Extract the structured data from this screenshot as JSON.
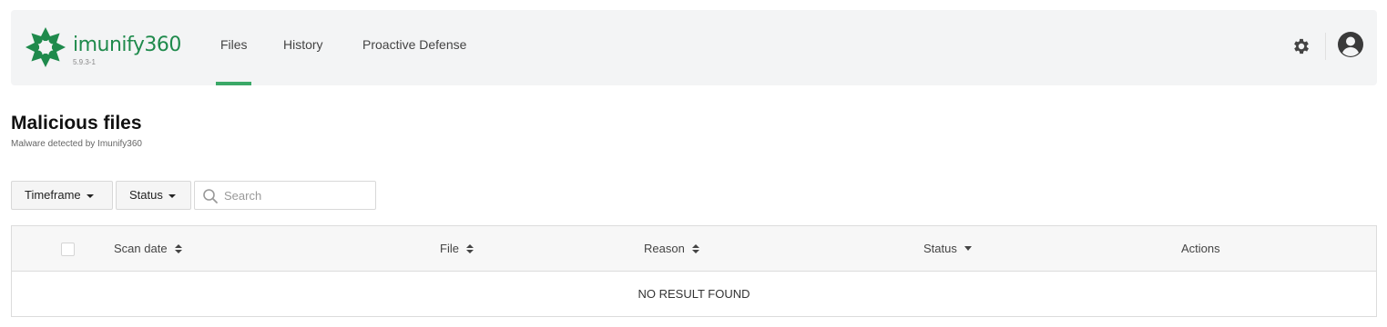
{
  "brand": {
    "name": "imunify360",
    "version": "5.9.3-1",
    "color": "#1f8a4c"
  },
  "nav": {
    "tabs": [
      {
        "label": "Files",
        "active": true
      },
      {
        "label": "History",
        "active": false
      },
      {
        "label": "Proactive Defense",
        "active": false
      }
    ],
    "accent": "#3aa867",
    "right_icons": [
      "gear-icon",
      "user-avatar-icon"
    ]
  },
  "page": {
    "title": "Malicious files",
    "subtitle": "Malware detected by Imunify360"
  },
  "filters": {
    "timeframe_label": "Timeframe",
    "status_label": "Status",
    "search_placeholder": "Search",
    "search_value": ""
  },
  "table": {
    "columns": [
      {
        "label": "Scan date",
        "sort": "both"
      },
      {
        "label": "File",
        "sort": "both"
      },
      {
        "label": "Reason",
        "sort": "both"
      },
      {
        "label": "Status",
        "sort": "desc"
      },
      {
        "label": "Actions",
        "sort": "none"
      }
    ],
    "empty_message": "NO RESULT FOUND",
    "select_all_checked": false
  }
}
